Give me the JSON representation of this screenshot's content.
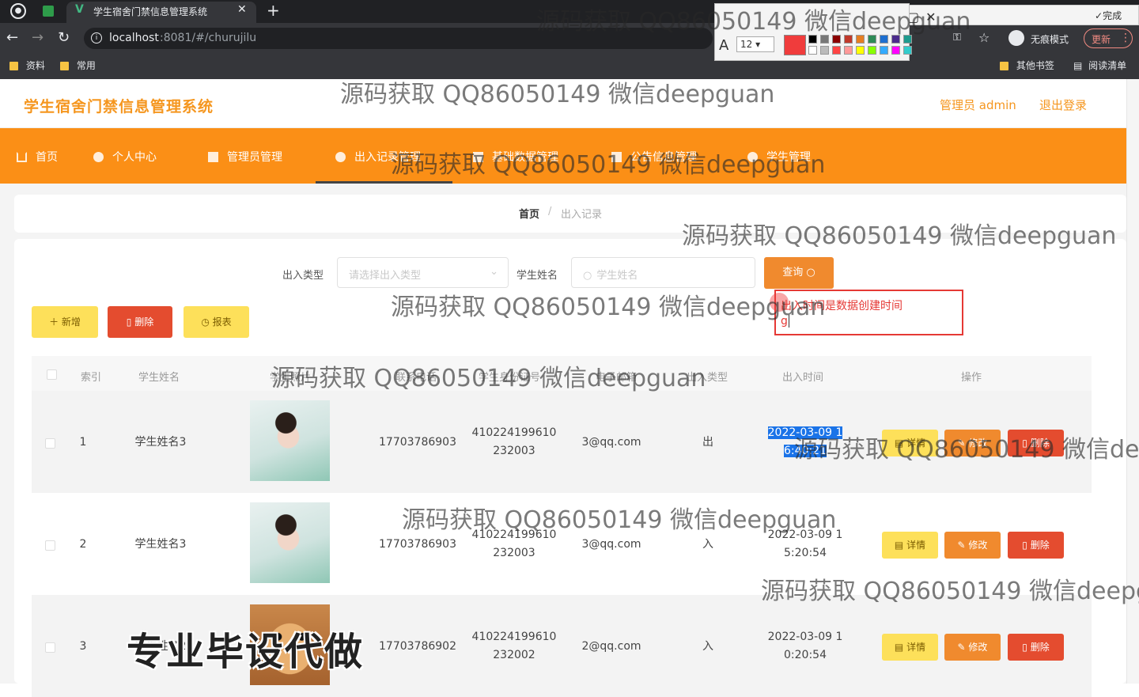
{
  "browser": {
    "tab_title": "学生宿舍门禁信息管理系统",
    "url_host": "localhost",
    "url_rest": ":8081/#/churujilu",
    "incognito_label": "无痕模式",
    "update_label": "更新",
    "bookmarks": [
      "资料",
      "常用"
    ],
    "bookmarks_right": [
      "其他书签",
      "阅读清单"
    ],
    "annotation_toolbar": {
      "done_label": "完成",
      "font_size": "12",
      "font_glyph": "A",
      "current_color": "#f03c3c"
    }
  },
  "site": {
    "title": "学生宿舍门禁信息管理系统",
    "user_label": "管理员 admin",
    "logout_label": "退出登录",
    "nav": [
      "首页",
      "个人中心",
      "管理员管理",
      "出入记录管理",
      "基础数据管理",
      "公告信息管理",
      "学生管理"
    ],
    "nav_active": "出入记录管理"
  },
  "breadcrumb": {
    "home": "首页",
    "sep": "/",
    "current": "出入记录"
  },
  "search": {
    "type_label": "出入类型",
    "type_placeholder": "请选择出入类型",
    "name_label": "学生姓名",
    "name_placeholder": "学生姓名",
    "query_label": "查询"
  },
  "toolbar": {
    "add_label": "新增",
    "delete_label": "删除",
    "report_label": "报表"
  },
  "annotation": {
    "line1": "出入时间是数据创建时间",
    "line2": "g"
  },
  "table": {
    "headers": [
      "索引",
      "学生姓名",
      "学生照片",
      "联系电话",
      "学生身份证号",
      "电子邮箱",
      "出入类型",
      "出入时间",
      "操作"
    ],
    "actions": {
      "detail": "详情",
      "edit": "修改",
      "delete": "删除"
    },
    "rows": [
      {
        "index": "1",
        "name": "学生姓名3",
        "phone": "17703786903",
        "id_a": "410224199610",
        "id_b": "232003",
        "email": "3@qq.com",
        "type": "出",
        "time_a": "2022-03-09 1",
        "time_b": "6:40:21"
      },
      {
        "index": "2",
        "name": "学生姓名3",
        "phone": "17703786903",
        "id_a": "410224199610",
        "id_b": "232003",
        "email": "3@qq.com",
        "type": "入",
        "time_a": "2022-03-09 1",
        "time_b": "5:20:54"
      },
      {
        "index": "3",
        "name": "学生姓名2",
        "phone": "17703786902",
        "id_a": "410224199610",
        "id_b": "232002",
        "email": "2@qq.com",
        "type": "入",
        "time_a": "2022-03-09 1",
        "time_b": "0:20:54"
      }
    ]
  },
  "watermarks": {
    "text": "源码获取 QQ86050149 微信deepguan",
    "big": "专业毕设代做"
  }
}
